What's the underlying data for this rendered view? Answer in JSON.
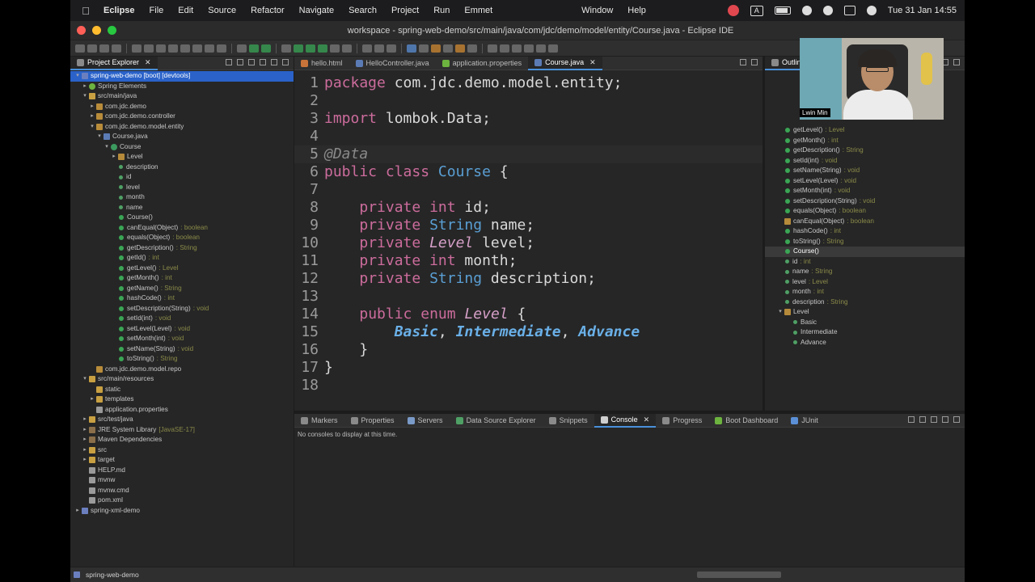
{
  "menubar": {
    "app": "Eclipse",
    "items": [
      "File",
      "Edit",
      "Source",
      "Refactor",
      "Navigate",
      "Search",
      "Project",
      "Run",
      "Emmet"
    ],
    "right_items": [
      "Window",
      "Help"
    ],
    "input_indicator": "A",
    "clock": "Tue 31 Jan  14:55"
  },
  "window": {
    "title": "workspace - spring-web-demo/src/main/java/com/jdc/demo/model/entity/Course.java - Eclipse IDE"
  },
  "explorer": {
    "tab_label": "Project Explorer",
    "rows": [
      {
        "indent": 0,
        "arrow": "▾",
        "icon": "proj",
        "label": "spring-web-demo [boot] [devtools]",
        "selected": true
      },
      {
        "indent": 1,
        "arrow": "▸",
        "icon": "spring",
        "label": "Spring Elements"
      },
      {
        "indent": 1,
        "arrow": "▾",
        "icon": "folder",
        "label": "src/main/java"
      },
      {
        "indent": 2,
        "arrow": "▸",
        "icon": "pkg",
        "label": "com.jdc.demo"
      },
      {
        "indent": 2,
        "arrow": "▸",
        "icon": "pkg",
        "label": "com.jdc.demo.controller"
      },
      {
        "indent": 2,
        "arrow": "▾",
        "icon": "pkg",
        "label": "com.jdc.demo.model.entity"
      },
      {
        "indent": 3,
        "arrow": "▾",
        "icon": "java",
        "label": "Course.java"
      },
      {
        "indent": 4,
        "arrow": "▾",
        "icon": "class",
        "label": "Course"
      },
      {
        "indent": 5,
        "arrow": "▸",
        "icon": "enum",
        "label": "Level"
      },
      {
        "indent": 5,
        "arrow": "",
        "icon": "field",
        "label": "description"
      },
      {
        "indent": 5,
        "arrow": "",
        "icon": "field",
        "label": "id"
      },
      {
        "indent": 5,
        "arrow": "",
        "icon": "field",
        "label": "level"
      },
      {
        "indent": 5,
        "arrow": "",
        "icon": "field",
        "label": "month"
      },
      {
        "indent": 5,
        "arrow": "",
        "icon": "field",
        "label": "name"
      },
      {
        "indent": 5,
        "arrow": "",
        "icon": "method",
        "label": "Course()"
      },
      {
        "indent": 5,
        "arrow": "",
        "icon": "method",
        "label": "canEqual(Object)",
        "ret": ": boolean"
      },
      {
        "indent": 5,
        "arrow": "",
        "icon": "method",
        "label": "equals(Object)",
        "ret": ": boolean"
      },
      {
        "indent": 5,
        "arrow": "",
        "icon": "method",
        "label": "getDescription()",
        "ret": ": String"
      },
      {
        "indent": 5,
        "arrow": "",
        "icon": "method",
        "label": "getId()",
        "ret": ": int"
      },
      {
        "indent": 5,
        "arrow": "",
        "icon": "method",
        "label": "getLevel()",
        "ret": ": Level"
      },
      {
        "indent": 5,
        "arrow": "",
        "icon": "method",
        "label": "getMonth()",
        "ret": ": int"
      },
      {
        "indent": 5,
        "arrow": "",
        "icon": "method",
        "label": "getName()",
        "ret": ": String"
      },
      {
        "indent": 5,
        "arrow": "",
        "icon": "method",
        "label": "hashCode()",
        "ret": ": int"
      },
      {
        "indent": 5,
        "arrow": "",
        "icon": "method",
        "label": "setDescription(String)",
        "ret": ": void"
      },
      {
        "indent": 5,
        "arrow": "",
        "icon": "method",
        "label": "setId(int)",
        "ret": ": void"
      },
      {
        "indent": 5,
        "arrow": "",
        "icon": "method",
        "label": "setLevel(Level)",
        "ret": ": void"
      },
      {
        "indent": 5,
        "arrow": "",
        "icon": "method",
        "label": "setMonth(int)",
        "ret": ": void"
      },
      {
        "indent": 5,
        "arrow": "",
        "icon": "method",
        "label": "setName(String)",
        "ret": ": void"
      },
      {
        "indent": 5,
        "arrow": "",
        "icon": "method",
        "label": "toString()",
        "ret": ": String"
      },
      {
        "indent": 2,
        "arrow": "",
        "icon": "pkg",
        "label": "com.jdc.demo.model.repo"
      },
      {
        "indent": 1,
        "arrow": "▾",
        "icon": "folder",
        "label": "src/main/resources"
      },
      {
        "indent": 2,
        "arrow": "",
        "icon": "folder",
        "label": "static"
      },
      {
        "indent": 2,
        "arrow": "▸",
        "icon": "folder",
        "label": "templates"
      },
      {
        "indent": 2,
        "arrow": "",
        "icon": "file",
        "label": "application.properties"
      },
      {
        "indent": 1,
        "arrow": "▸",
        "icon": "folder",
        "label": "src/test/java"
      },
      {
        "indent": 1,
        "arrow": "▸",
        "icon": "lib",
        "label": "JRE System Library",
        "deco": "[JavaSE-17]"
      },
      {
        "indent": 1,
        "arrow": "▸",
        "icon": "lib",
        "label": "Maven Dependencies"
      },
      {
        "indent": 1,
        "arrow": "▸",
        "icon": "folder",
        "label": "src"
      },
      {
        "indent": 1,
        "arrow": "▸",
        "icon": "folder",
        "label": "target"
      },
      {
        "indent": 1,
        "arrow": "",
        "icon": "file",
        "label": "HELP.md"
      },
      {
        "indent": 1,
        "arrow": "",
        "icon": "file",
        "label": "mvnw"
      },
      {
        "indent": 1,
        "arrow": "",
        "icon": "file",
        "label": "mvnw.cmd"
      },
      {
        "indent": 1,
        "arrow": "",
        "icon": "file",
        "label": "pom.xml"
      },
      {
        "indent": 0,
        "arrow": "▸",
        "icon": "proj",
        "label": "spring-xml-demo"
      }
    ]
  },
  "editor": {
    "tabs": [
      {
        "label": "hello.html",
        "color": "#c9743a"
      },
      {
        "label": "HelloController.java",
        "color": "#5b7bb5"
      },
      {
        "label": "application.properties",
        "color": "#6db33f"
      },
      {
        "label": "Course.java",
        "color": "#5b7bb5",
        "active": true
      }
    ],
    "lines": [
      {
        "n": "1",
        "html": "<span class=\"kw\">package</span> com.jdc.demo.model.entity;"
      },
      {
        "n": "2",
        "html": ""
      },
      {
        "n": "3",
        "html": "<span class=\"kw\">import</span> lombok.Data;"
      },
      {
        "n": "4",
        "html": ""
      },
      {
        "n": "5",
        "html": "<span class=\"ann\">@Data</span>",
        "hl": true
      },
      {
        "n": "6",
        "html": "<span class=\"kw\">public</span> <span class=\"kw\">class</span> <span class=\"ty\">Course</span> {"
      },
      {
        "n": "7",
        "html": ""
      },
      {
        "n": "8",
        "html": "    <span class=\"kw\">private</span> <span class=\"kt\">int</span> id;"
      },
      {
        "n": "9",
        "html": "    <span class=\"kw\">private</span> <span class=\"ty\">String</span> name;"
      },
      {
        "n": "10",
        "html": "    <span class=\"kw\">private</span> <span class=\"it\">Level</span> level;"
      },
      {
        "n": "11",
        "html": "    <span class=\"kw\">private</span> <span class=\"kt\">int</span> month;"
      },
      {
        "n": "12",
        "html": "    <span class=\"kw\">private</span> <span class=\"ty\">String</span> description;"
      },
      {
        "n": "13",
        "html": ""
      },
      {
        "n": "14",
        "html": "    <span class=\"kw\">public</span> <span class=\"kw\">enum</span> <span class=\"it\">Level</span> {"
      },
      {
        "n": "15",
        "html": "        <span class=\"en\">Basic</span>, <span class=\"en\">Intermediate</span>, <span class=\"en\">Advance</span>"
      },
      {
        "n": "16",
        "html": "    }"
      },
      {
        "n": "17",
        "html": "}"
      },
      {
        "n": "18",
        "html": ""
      }
    ]
  },
  "outline": {
    "tab_label": "Outline",
    "rows": [
      {
        "indent": 2,
        "icon": "method",
        "label": "getLevel()",
        "ret": ": Level"
      },
      {
        "indent": 2,
        "icon": "method",
        "label": "getMonth()",
        "ret": ": int"
      },
      {
        "indent": 2,
        "icon": "method",
        "label": "getDescription()",
        "ret": ": String"
      },
      {
        "indent": 2,
        "icon": "method",
        "label": "setId(int)",
        "ret": ": void"
      },
      {
        "indent": 2,
        "icon": "method",
        "label": "setName(String)",
        "ret": ": void"
      },
      {
        "indent": 2,
        "icon": "method",
        "label": "setLevel(Level)",
        "ret": ": void"
      },
      {
        "indent": 2,
        "icon": "method",
        "label": "setMonth(int)",
        "ret": ": void"
      },
      {
        "indent": 2,
        "icon": "method",
        "label": "setDescription(String)",
        "ret": ": void"
      },
      {
        "indent": 2,
        "icon": "method",
        "label": "equals(Object)",
        "ret": ": boolean"
      },
      {
        "indent": 2,
        "icon": "enum",
        "label": "canEqual(Object)",
        "ret": ": boolean"
      },
      {
        "indent": 2,
        "icon": "method",
        "label": "hashCode()",
        "ret": ": int"
      },
      {
        "indent": 2,
        "icon": "method",
        "label": "toString()",
        "ret": ": String"
      },
      {
        "indent": 2,
        "icon": "method",
        "label": "Course()",
        "ret": "",
        "selected": true
      },
      {
        "indent": 2,
        "icon": "field",
        "label": "id",
        "ret": ": int"
      },
      {
        "indent": 2,
        "icon": "field",
        "label": "name",
        "ret": ": String"
      },
      {
        "indent": 2,
        "icon": "field",
        "label": "level",
        "ret": ": Level"
      },
      {
        "indent": 2,
        "icon": "field",
        "label": "month",
        "ret": ": int"
      },
      {
        "indent": 2,
        "icon": "field",
        "label": "description",
        "ret": ": String"
      },
      {
        "indent": 1,
        "icon": "enum",
        "label": "Level",
        "ret": "",
        "arrow": "▾"
      },
      {
        "indent": 3,
        "icon": "field",
        "label": "Basic",
        "ret": ""
      },
      {
        "indent": 3,
        "icon": "field",
        "label": "Intermediate",
        "ret": ""
      },
      {
        "indent": 3,
        "icon": "field",
        "label": "Advance",
        "ret": ""
      }
    ]
  },
  "webcam": {
    "name": "Lwin Min"
  },
  "console": {
    "tabs": [
      {
        "label": "Markers",
        "color": "#8a8a8a"
      },
      {
        "label": "Properties",
        "color": "#8a8a8a"
      },
      {
        "label": "Servers",
        "color": "#7a9ac8"
      },
      {
        "label": "Data Source Explorer",
        "color": "#4fa065"
      },
      {
        "label": "Snippets",
        "color": "#8a8a8a"
      },
      {
        "label": "Console",
        "color": "#cfcfcf",
        "active": true
      },
      {
        "label": "Progress",
        "color": "#8a8a8a"
      },
      {
        "label": "Boot Dashboard",
        "color": "#6db33f"
      },
      {
        "label": "JUnit",
        "color": "#5b8fd6"
      }
    ],
    "message": "No consoles to display at this time."
  },
  "status": {
    "project": "spring-web-demo"
  }
}
